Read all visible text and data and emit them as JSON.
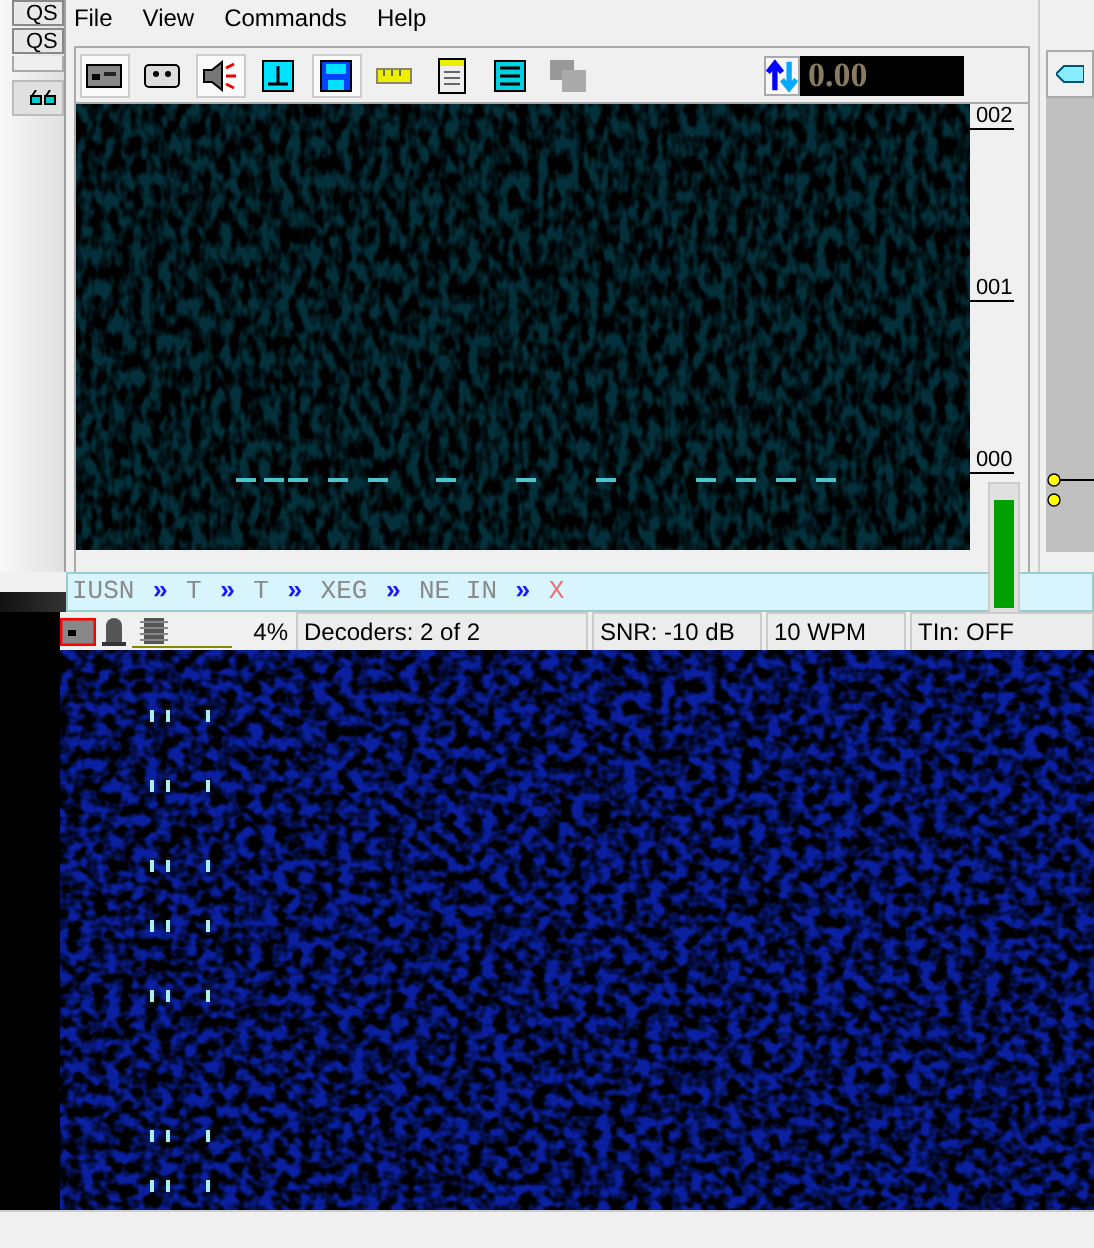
{
  "background_window": {
    "items": [
      "QS",
      "QS"
    ]
  },
  "menu": [
    "File",
    "View",
    "Commands",
    "Help"
  ],
  "toolbar": [
    {
      "kind": "radio",
      "selected": true
    },
    {
      "kind": "cassette",
      "selected": false
    },
    {
      "kind": "speaker",
      "selected": true
    },
    {
      "kind": "tune",
      "selected": false
    },
    {
      "kind": "save",
      "selected": true
    },
    {
      "kind": "ruler",
      "selected": false
    },
    {
      "kind": "notes",
      "selected": false
    },
    {
      "kind": "bars",
      "selected": false
    },
    {
      "kind": "pages",
      "selected": false
    }
  ],
  "readout": {
    "value": "0.00"
  },
  "scale": {
    "labels": [
      "002",
      "001",
      "000"
    ]
  },
  "meter": {
    "level": 0.9
  },
  "decoded_text": [
    {
      "kind": "text",
      "text": "IUSN"
    },
    {
      "kind": "sep",
      "text": "»"
    },
    {
      "kind": "text",
      "text": "T"
    },
    {
      "kind": "sep",
      "text": "»"
    },
    {
      "kind": "text",
      "text": "T"
    },
    {
      "kind": "sep",
      "text": "»"
    },
    {
      "kind": "text",
      "text": "XEG"
    },
    {
      "kind": "sep",
      "text": "»"
    },
    {
      "kind": "text",
      "text": "NE IN"
    },
    {
      "kind": "sep",
      "text": "»"
    },
    {
      "kind": "error",
      "text": "X"
    }
  ],
  "status_bar": {
    "cpu": "4%",
    "decoders": "Decoders: 2 of 2",
    "snr": "SNR: -10 dB",
    "speed": "10 WPM",
    "tin": "TIn: OFF"
  }
}
